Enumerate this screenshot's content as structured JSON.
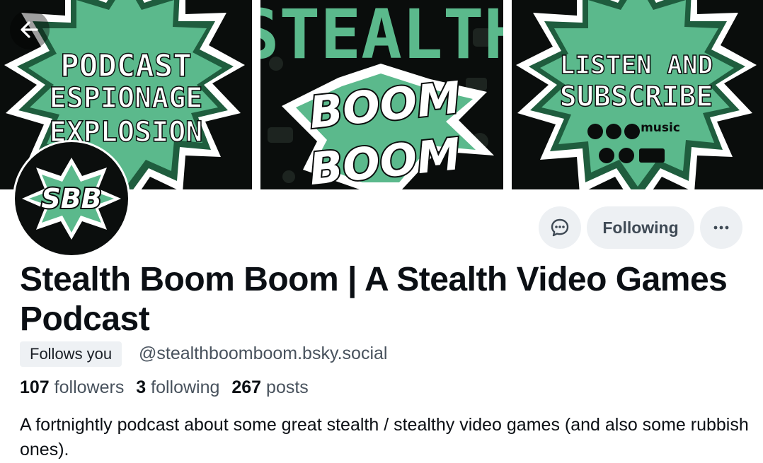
{
  "banner": {
    "panel_left_lines": [
      "PODCAST",
      "ESPIONAGE",
      "EXPLOSION"
    ],
    "panel_middle": {
      "top_word": "STEALTH",
      "word_1": "BOOM",
      "word_2": "BOOM"
    },
    "panel_right_lines": [
      "LISTEN AND",
      "SUBSCRIBE"
    ],
    "panel_right_music": "music",
    "colors": {
      "green": "#5bb98c",
      "dark_green": "#1f5d3e",
      "black": "#0a0d0c",
      "white": "#ffffff"
    }
  },
  "avatar": {
    "initials": "SBB"
  },
  "actions": {
    "following_label": "Following",
    "message_icon": "chat-bubble-icon",
    "more_icon": "ellipsis-icon"
  },
  "profile": {
    "display_name": "Stealth Boom Boom | A Stealth Video Games Podcast",
    "follows_you": "Follows you",
    "handle": "@stealthboomboom.bsky.social",
    "stats": {
      "followers_count": "107",
      "followers_label": "followers",
      "following_count": "3",
      "following_label": "following",
      "posts_count": "267",
      "posts_label": "posts"
    },
    "bio": "A fortnightly podcast about some great stealth / stealthy video games (and also some rubbish ones)."
  }
}
